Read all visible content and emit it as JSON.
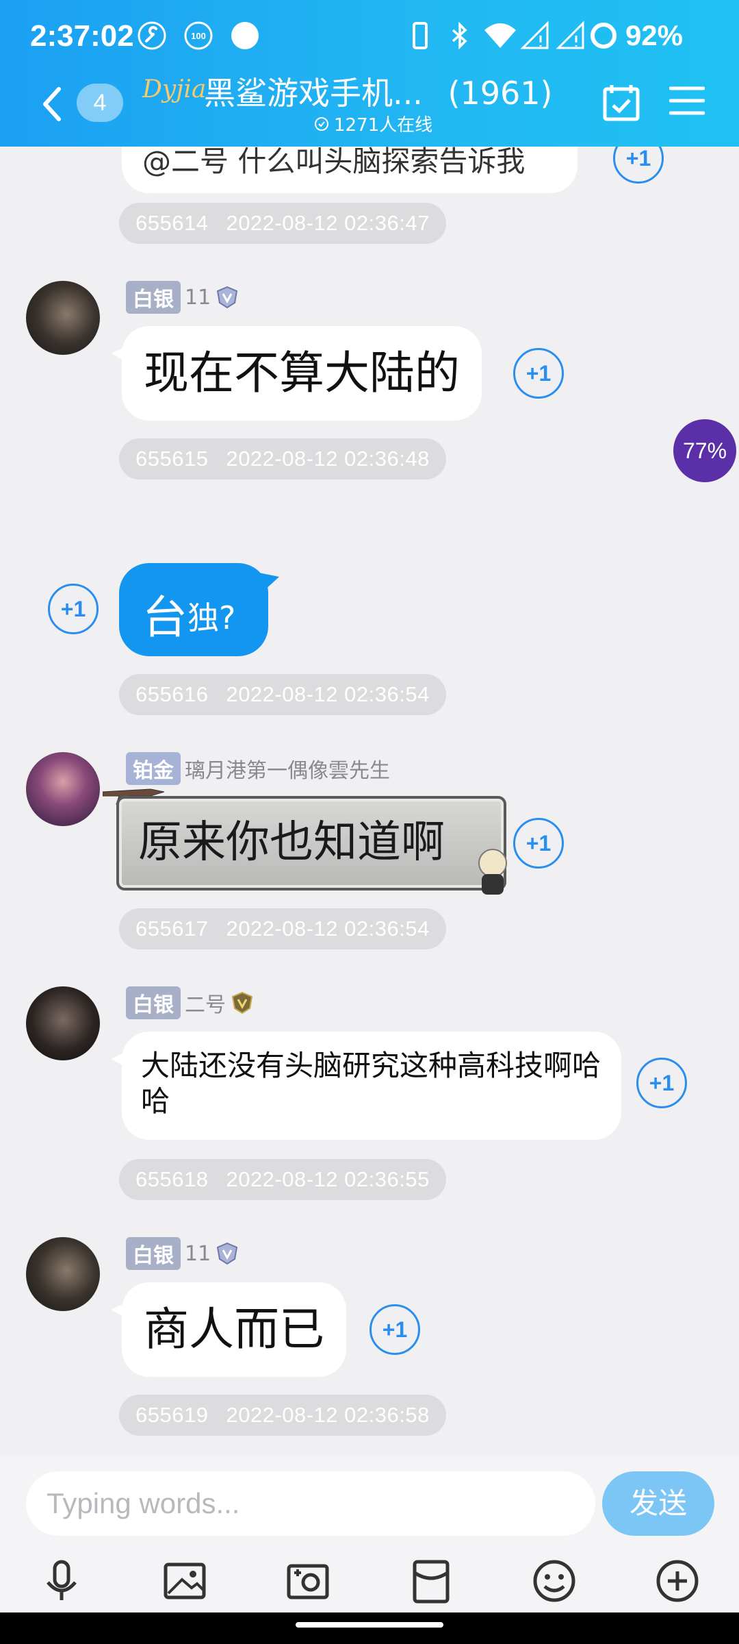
{
  "status_bar": {
    "time": "2:37:02",
    "battery": "92%",
    "icons": [
      "wrench-icon",
      "data-saver-100-icon",
      "dot-icon",
      "phone-icon",
      "bluetooth-icon",
      "wifi-icon",
      "signal-icon",
      "signal-icon",
      "battery-ring-icon"
    ]
  },
  "header": {
    "unread_badge": "4",
    "logo_text": "Dyjia",
    "group_title": "黑鲨游戏手机...",
    "member_count": "(1961)",
    "online_text": "1271人在线"
  },
  "chat": {
    "top_partial_text": "@二号 什么叫头脑探索告诉我",
    "floating_percent": "77%",
    "plus_label": "+1",
    "messages": [
      {
        "id": "655614",
        "time": "2022-08-12 02:36:47"
      },
      {
        "rank": "白银",
        "user": "11",
        "text": "现在不算大陆的",
        "id": "655615",
        "time": "2022-08-12 02:36:48"
      },
      {
        "mine": true,
        "text_a": "台",
        "text_b": "独?",
        "id": "655616",
        "time": "2022-08-12 02:36:54"
      },
      {
        "rank": "铂金",
        "user": "璃月港第一偶像雲先生",
        "text": "原来你也知道啊",
        "id": "655617",
        "time": "2022-08-12 02:36:54"
      },
      {
        "rank": "白银",
        "user": "二号",
        "text": "大陆还没有头脑研究这种高科技啊哈哈",
        "id": "655618",
        "time": "2022-08-12 02:36:55"
      },
      {
        "rank": "白银",
        "user": "11",
        "text": "商人而已",
        "id": "655619",
        "time": "2022-08-12 02:36:58"
      }
    ]
  },
  "input_bar": {
    "placeholder": "Typing words...",
    "send_label": "发送",
    "tools": [
      "microphone-icon",
      "image-icon",
      "camera-icon",
      "red-packet-icon",
      "emoji-icon",
      "plus-icon"
    ]
  },
  "colors": {
    "header_gradient_start": "#1ba0f2",
    "header_gradient_end": "#1fc1f3",
    "my_bubble": "#1296f0",
    "plus_one": "#2a8ef0",
    "send_button": "#7cc6f6",
    "percent_badge": "#5a2fa8"
  }
}
